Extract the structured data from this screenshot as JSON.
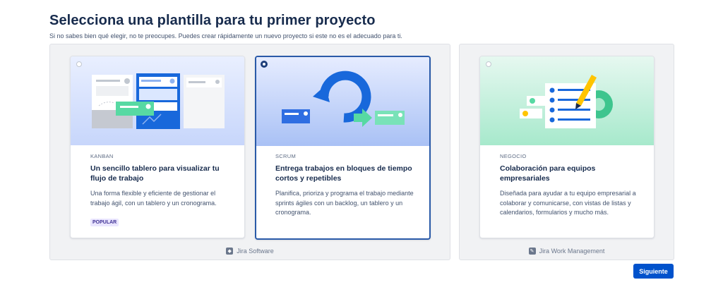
{
  "page": {
    "title": "Selecciona una plantilla para tu primer proyecto",
    "subtitle": "Si no sabes bien qué elegir, no te preocupes. Puedes crear rápidamente un nuevo proyecto si este no es el adecuado para ti."
  },
  "groups": [
    {
      "product": "Jira Software",
      "product_icon": "jira-software-icon",
      "templates": [
        {
          "tag": "KANBAN",
          "heading": "Un sencillo tablero para visualizar tu flujo de trabajo",
          "description": "Una forma flexible y eficiente de gestionar el trabajo ágil, con un tablero y un cronograma.",
          "badge": "POPULAR",
          "selected": false,
          "illustration": "kanban-board-illustration"
        },
        {
          "tag": "SCRUM",
          "heading": "Entrega trabajos en bloques de tiempo cortos y repetibles",
          "description": "Planifica, prioriza y programa el trabajo mediante sprints ágiles con un backlog, un tablero y un cronograma.",
          "selected": true,
          "illustration": "sprint-cycle-illustration"
        }
      ]
    },
    {
      "product": "Jira Work Management",
      "product_icon": "jira-work-management-icon",
      "templates": [
        {
          "tag": "NEGOCIO",
          "heading": "Colaboración para equipos empresariales",
          "description": "Diseñada para ayudar a tu equipo empresarial a colaborar y comunicarse, con vistas de listas y calendarios, formularios y mucho más.",
          "selected": false,
          "illustration": "business-checklist-illustration"
        }
      ]
    }
  ],
  "actions": {
    "next_label": "Siguiente"
  },
  "colors": {
    "primary_button": "#0052cc",
    "selected_border": "#2a5aa8",
    "group_background": "#f1f2f4",
    "badge_background": "#eae6ff",
    "badge_text": "#403294"
  }
}
